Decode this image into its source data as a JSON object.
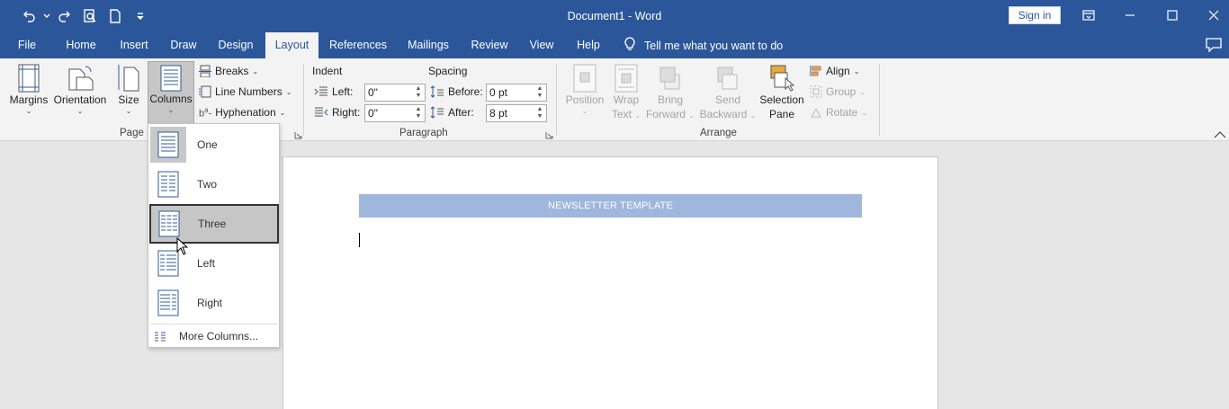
{
  "window": {
    "title": "Document1  -  Word",
    "signin_label": "Sign in",
    "accent": "#2b579a"
  },
  "qat": {
    "icons": [
      "undo-icon",
      "redo-icon",
      "print-preview-icon",
      "new-document-icon",
      "customize-qat-icon"
    ]
  },
  "tabs": [
    {
      "label": "File"
    },
    {
      "label": "Home"
    },
    {
      "label": "Insert"
    },
    {
      "label": "Draw"
    },
    {
      "label": "Design"
    },
    {
      "label": "Layout",
      "active": true
    },
    {
      "label": "References"
    },
    {
      "label": "Mailings"
    },
    {
      "label": "Review"
    },
    {
      "label": "View"
    },
    {
      "label": "Help"
    }
  ],
  "tell_me": "Tell me what you want to do",
  "page_setup": {
    "margins": "Margins",
    "orientation": "Orientation",
    "size": "Size",
    "columns": "Columns",
    "breaks": "Breaks",
    "line_numbers": "Line Numbers",
    "hyphenation": "Hyphenation",
    "group_label": "Page S"
  },
  "paragraph": {
    "indent_label": "Indent",
    "spacing_label": "Spacing",
    "left_label": "Left:",
    "right_label": "Right:",
    "before_label": "Before:",
    "after_label": "After:",
    "left_value": "0\"",
    "right_value": "0\"",
    "before_value": "0 pt",
    "after_value": "8 pt",
    "group_label": "Paragraph"
  },
  "arrange": {
    "position_1": "Position",
    "wrap_1": "Wrap",
    "wrap_2": "Text",
    "bring_1": "Bring",
    "bring_2": "Forward",
    "send_1": "Send",
    "send_2": "Backward",
    "selection_1": "Selection",
    "selection_2": "Pane",
    "align": "Align",
    "group": "Group",
    "rotate": "Rotate",
    "group_label": "Arrange"
  },
  "columns_menu": {
    "items": [
      {
        "label": "One"
      },
      {
        "label": "Two"
      },
      {
        "label": "Three"
      },
      {
        "label": "Left"
      },
      {
        "label": "Right"
      }
    ],
    "more": "More Columns..."
  },
  "document": {
    "banner": "NEWSLETTER TEMPLATE",
    "banner_color": "#9fb6dd"
  }
}
